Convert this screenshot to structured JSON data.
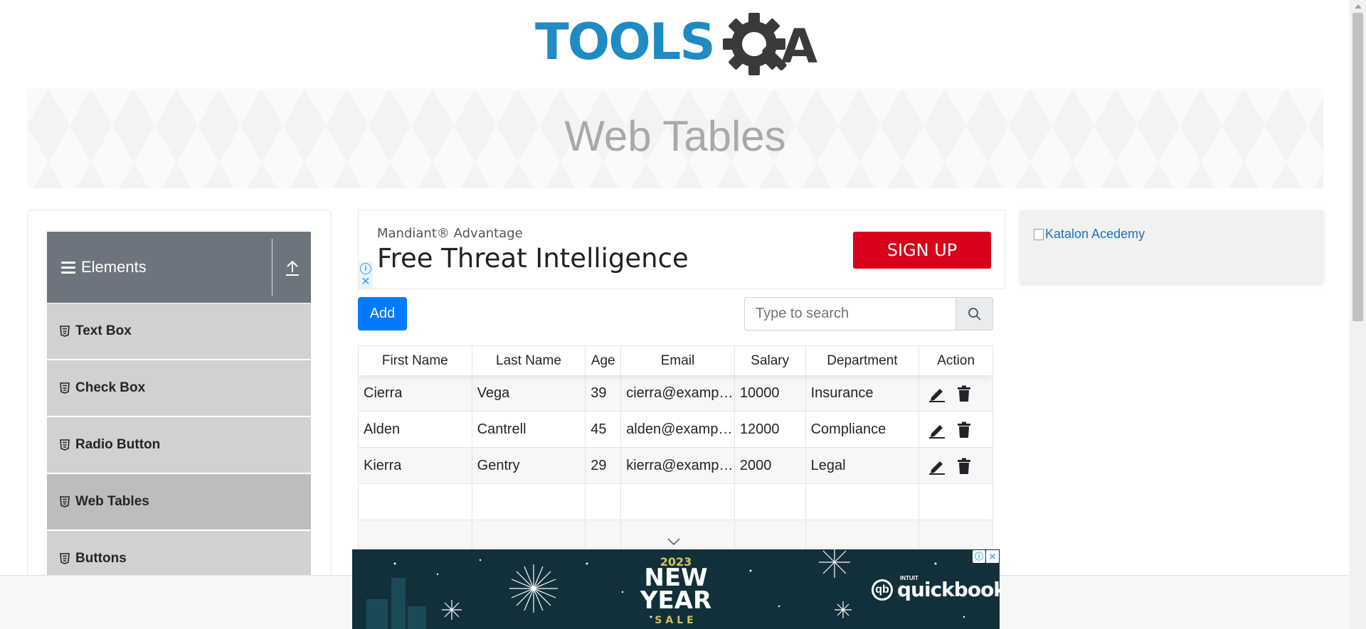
{
  "logo": {
    "brand_left": "TOOLS",
    "brand_right": "A"
  },
  "page": {
    "title": "Web Tables"
  },
  "sidebar": {
    "group_title": "Elements",
    "items": [
      {
        "label": "Text Box"
      },
      {
        "label": "Check Box"
      },
      {
        "label": "Radio Button"
      },
      {
        "label": "Web Tables",
        "active": true
      },
      {
        "label": "Buttons"
      }
    ]
  },
  "ad_top": {
    "subtitle": "Mandiant® Advantage",
    "headline": "Free Threat Intelligence",
    "cta": "SIGN UP",
    "info_glyph": "ⓘ",
    "close_glyph": "✕"
  },
  "right_ad": {
    "alt_text": "Katalon Acedemy"
  },
  "toolbar": {
    "add_label": "Add"
  },
  "search": {
    "placeholder": "Type to search"
  },
  "table": {
    "headers": [
      "First Name",
      "Last Name",
      "Age",
      "Email",
      "Salary",
      "Department",
      "Action"
    ],
    "rows": [
      {
        "first": "Cierra",
        "last": "Vega",
        "age": "39",
        "email": "cierra@example.com",
        "salary": "10000",
        "department": "Insurance"
      },
      {
        "first": "Alden",
        "last": "Cantrell",
        "age": "45",
        "email": "alden@example.com",
        "salary": "12000",
        "department": "Compliance"
      },
      {
        "first": "Kierra",
        "last": "Gentry",
        "age": "29",
        "email": "kierra@example.com",
        "salary": "2000",
        "department": "Legal"
      }
    ]
  },
  "ad_bottom": {
    "year": "2023",
    "line1": "NEW",
    "line2": "YEAR",
    "sale": "SALE",
    "brand_small": "INTUIT",
    "brand": "quickbooks",
    "brand_mark": "qb",
    "info_glyph": "ⓘ",
    "close_glyph": "✕"
  },
  "colors": {
    "primary": "#007bff",
    "sidebar_header": "#6c757d",
    "sidebar_item": "#d1d1d1",
    "sidebar_item_active": "#bdbdbd",
    "cta_red": "#d90019",
    "logo_blue": "#1e8bc3"
  }
}
